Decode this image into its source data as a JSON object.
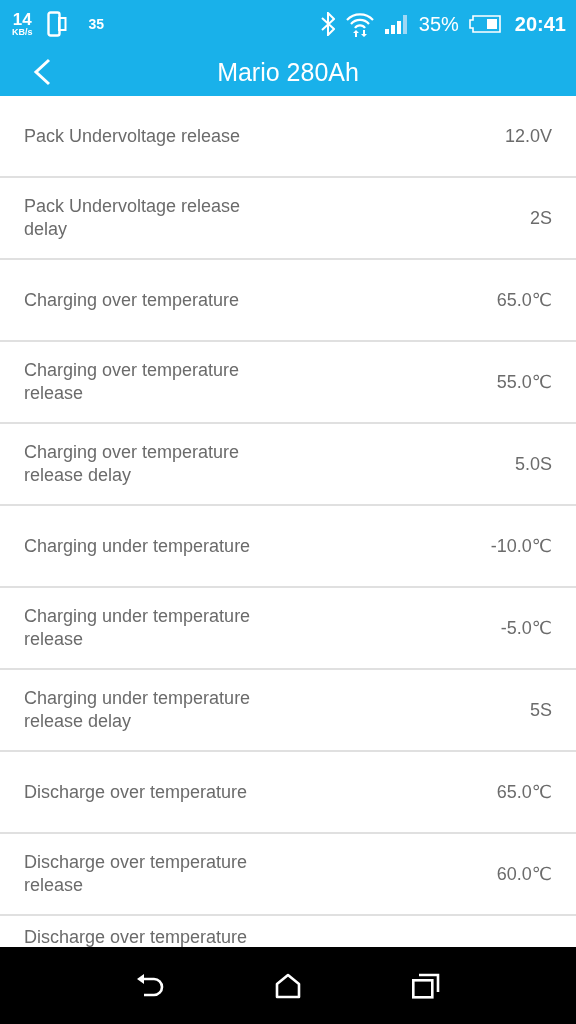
{
  "status_bar": {
    "speed": "14",
    "speed_unit": "KB/s",
    "notification_count": "35",
    "battery_percent": "35%",
    "time": "20:41"
  },
  "header": {
    "title": "Mario 280Ah"
  },
  "settings": [
    {
      "label": "Pack Undervoltage release",
      "value": "12.0V"
    },
    {
      "label": "Pack Undervoltage release delay",
      "value": "2S"
    },
    {
      "label": "Charging over temperature",
      "value": "65.0℃"
    },
    {
      "label": "Charging over temperature release",
      "value": "55.0℃"
    },
    {
      "label": "Charging over temperature release delay",
      "value": "5.0S"
    },
    {
      "label": "Charging under temperature",
      "value": "-10.0℃"
    },
    {
      "label": "Charging under temperature release",
      "value": "-5.0℃"
    },
    {
      "label": "Charging under temperature release delay",
      "value": "5S"
    },
    {
      "label": "Discharge over temperature",
      "value": "65.0℃"
    },
    {
      "label": "Discharge over temperature release",
      "value": "60.0℃"
    },
    {
      "label": "Discharge over temperature"
    }
  ]
}
